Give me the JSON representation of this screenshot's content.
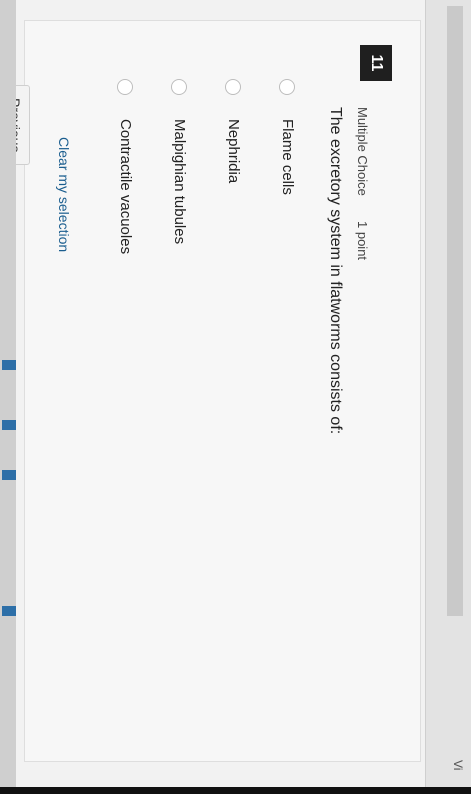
{
  "question": {
    "number": "11",
    "type": "Multiple Choice",
    "points": "1 point",
    "text": "The excretory system in flatworms consists of:"
  },
  "options": [
    {
      "label": "Flame cells"
    },
    {
      "label": "Nephridia"
    },
    {
      "label": "Malpighian tubules"
    },
    {
      "label": "Contractile vacuoles"
    }
  ],
  "actions": {
    "clear_label": "Clear my selection",
    "previous_label": "Previous"
  },
  "corner": {
    "text": "Vi"
  }
}
